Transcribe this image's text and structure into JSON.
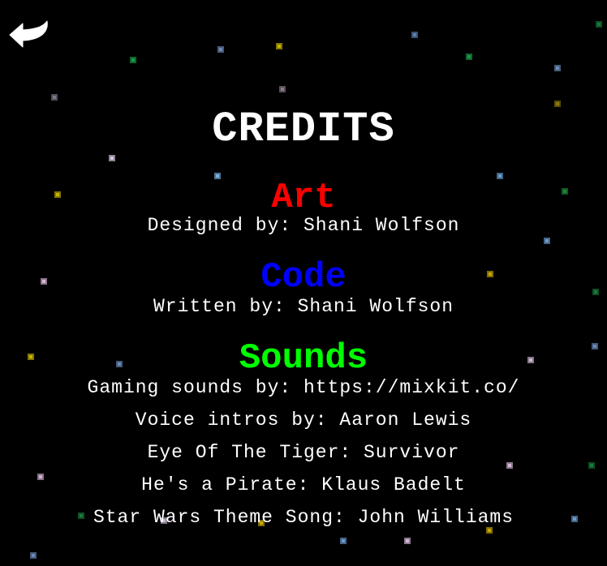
{
  "screen": {
    "title": "CREDITS",
    "back_icon": "back-arrow-icon",
    "colors": {
      "background": "#000000",
      "text": "#ffffff",
      "art": "#ff0000",
      "code": "#0000ff",
      "sounds": "#00ff00"
    }
  },
  "sections": {
    "art": {
      "heading": "Art",
      "lines": [
        "Designed by: Shani Wolfson"
      ]
    },
    "code": {
      "heading": "Code",
      "lines": [
        "Written by: Shani Wolfson"
      ]
    },
    "sounds": {
      "heading": "Sounds",
      "lines": [
        "Gaming sounds by: https://mixkit.co/",
        "Voice intros by: Aaron Lewis",
        "Eye Of The Tiger: Survivor",
        "He's a Pirate: Klaus Badelt",
        "Star Wars Theme Song: John Williams"
      ]
    }
  }
}
